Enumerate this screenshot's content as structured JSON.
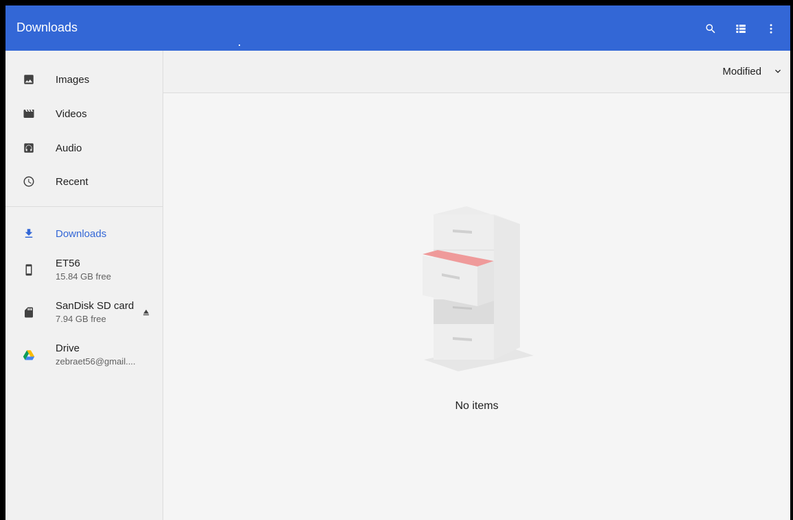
{
  "appbar": {
    "title": "Downloads",
    "actions": [
      {
        "icon": "search-icon"
      },
      {
        "icon": "list-view-icon"
      },
      {
        "icon": "more-vert-icon"
      }
    ]
  },
  "sidebar": {
    "items": [
      {
        "icon": "image-icon",
        "label": "Images"
      },
      {
        "icon": "video-icon",
        "label": "Videos"
      },
      {
        "icon": "audio-icon",
        "label": "Audio"
      },
      {
        "icon": "clock-icon",
        "label": "Recent"
      },
      {
        "icon": "download-icon",
        "label": "Downloads",
        "active": true
      },
      {
        "icon": "phone-icon",
        "label": "ET56",
        "sublabel": "15.84 GB free"
      },
      {
        "icon": "sd-card-icon",
        "label": "SanDisk SD card",
        "sublabel": "7.94 GB free",
        "eject_icon": "eject-icon"
      },
      {
        "icon": "drive-icon",
        "label": "Drive",
        "sublabel": "zebraet56@gmail...."
      }
    ]
  },
  "toolbar": {
    "sort_label": "Modified",
    "sort_icon": "chevron-down-icon"
  },
  "content": {
    "empty_message": "No items",
    "illustration": "file-cabinet-illustration"
  },
  "colors": {
    "accent": "#3367d6",
    "sidebar_bg": "#f1f1f1",
    "content_bg": "#f5f5f5",
    "drawer_highlight": "#ef9a9a"
  }
}
